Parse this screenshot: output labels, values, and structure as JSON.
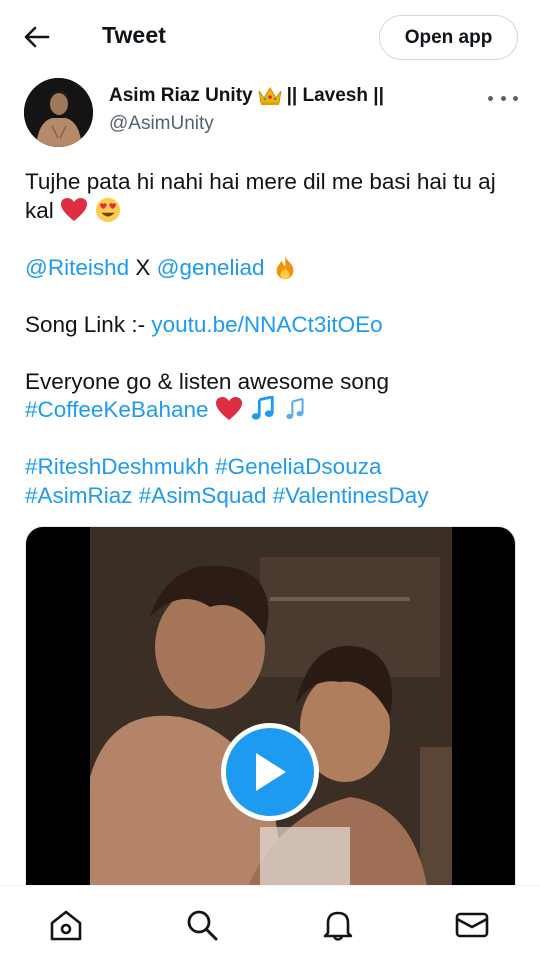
{
  "header": {
    "title": "Tweet",
    "open_app_label": "Open app"
  },
  "author": {
    "display_name_prefix": "Asim Riaz Unity",
    "display_name_suffix": "|| Lavesh ||",
    "handle": "@AsimUnity"
  },
  "tweet": {
    "line1": "Tujhe pata hi nahi hai mere dil me basi hai tu aj kal",
    "mention1": "@Riteishd",
    "mention_sep": " X ",
    "mention2": "@geneliad",
    "song_label": "Song Link :- ",
    "song_link": "youtu.be/NNACt3itOEo",
    "line_everyone": "Everyone go & listen awesome song",
    "hashtag_coffee": "#CoffeeKeBahane",
    "hashtags_line1": [
      "#RiteshDeshmukh",
      "#GeneliaDsouza"
    ],
    "hashtags_line2": [
      "#AsimRiaz",
      "#AsimSquad",
      "#ValentinesDay"
    ]
  },
  "icons": {
    "back": "arrow-left-icon",
    "more": "more-horizontal-icon",
    "play": "play-icon",
    "home": "home-icon",
    "search": "search-icon",
    "notifications": "bell-icon",
    "messages": "mail-icon"
  },
  "colors": {
    "accent": "#1d9bf0",
    "text": "#0f1419",
    "secondary": "#536471",
    "heart": "#e0245e"
  }
}
